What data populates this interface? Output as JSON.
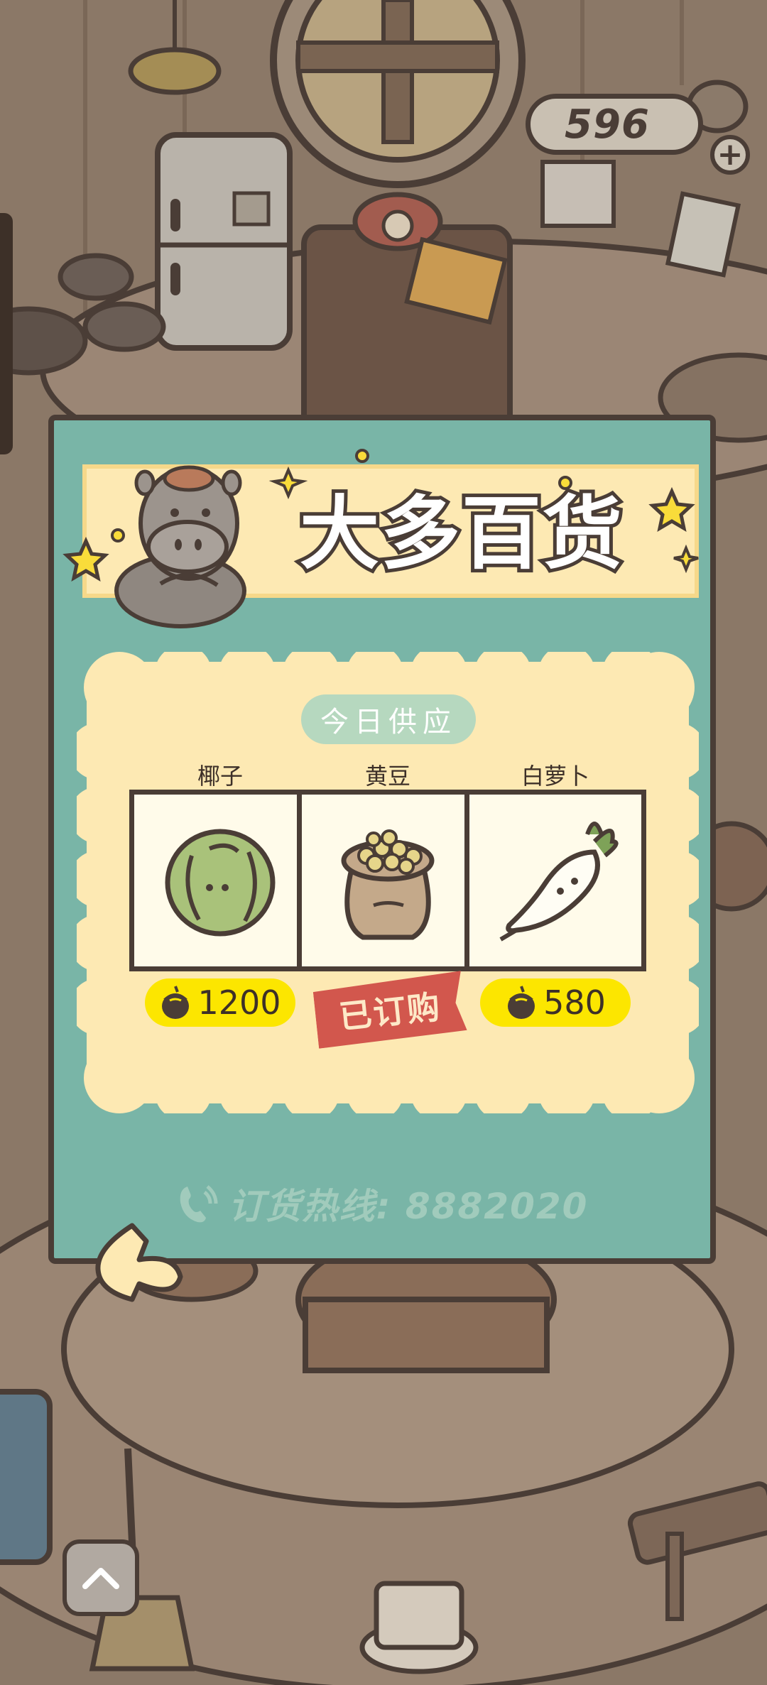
{
  "hud": {
    "coins": "596",
    "add_label": "+"
  },
  "shop": {
    "title": "大多百货",
    "supply_title": "今日供应",
    "items": [
      {
        "name": "椰子",
        "price": "1200",
        "status": ""
      },
      {
        "name": "黄豆",
        "price": "",
        "status": "已订购"
      },
      {
        "name": "白萝卜",
        "price": "580",
        "status": ""
      }
    ],
    "hotline": "订货热线: 8882020"
  },
  "icons": {
    "coin": "acorn-coin-icon",
    "phone": "phone-icon",
    "back": "back-arrow-icon",
    "up": "chevron-up-icon"
  },
  "colors": {
    "panel": "#79b5a7",
    "banner": "#fde9b3",
    "price_tag": "#fce600",
    "ordered_stamp": "#d2574d",
    "outline": "#4a3d36"
  }
}
